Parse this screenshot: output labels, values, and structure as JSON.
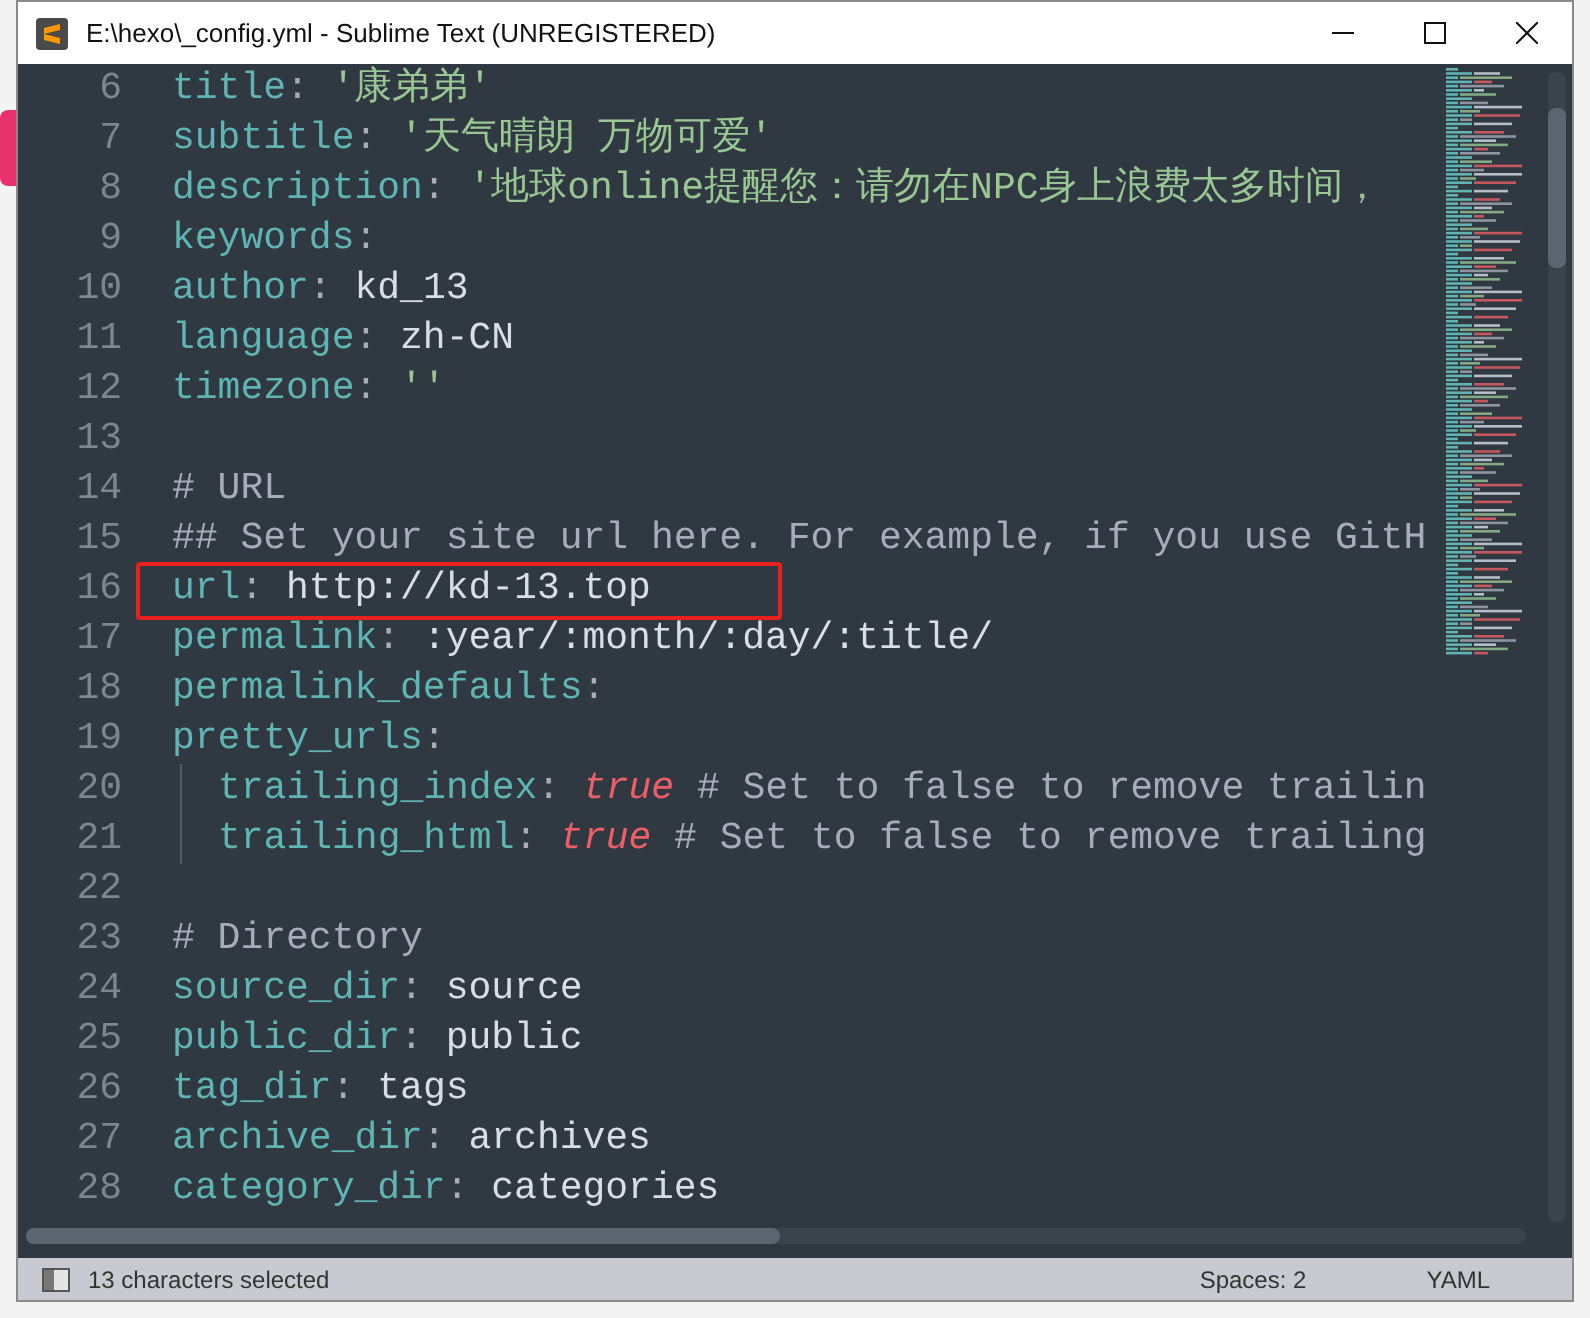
{
  "window": {
    "title": "E:\\hexo\\_config.yml - Sublime Text (UNREGISTERED)"
  },
  "lines": [
    {
      "number": "6",
      "indented": false,
      "boxed": false,
      "tokens": [
        {
          "kind": "key",
          "text": "title"
        },
        {
          "kind": "punct",
          "text": ": "
        },
        {
          "kind": "string",
          "text": "'康弟弟'"
        }
      ]
    },
    {
      "number": "7",
      "indented": false,
      "boxed": false,
      "tokens": [
        {
          "kind": "key",
          "text": "subtitle"
        },
        {
          "kind": "punct",
          "text": ": "
        },
        {
          "kind": "string",
          "text": "'天气晴朗 万物可爱'"
        }
      ]
    },
    {
      "number": "8",
      "indented": false,
      "boxed": false,
      "tokens": [
        {
          "kind": "key",
          "text": "description"
        },
        {
          "kind": "punct",
          "text": ": "
        },
        {
          "kind": "string",
          "text": "'地球online提醒您：请勿在NPC身上浪费太多时间，"
        }
      ]
    },
    {
      "number": "9",
      "indented": false,
      "boxed": false,
      "tokens": [
        {
          "kind": "key",
          "text": "keywords"
        },
        {
          "kind": "punct",
          "text": ":"
        }
      ]
    },
    {
      "number": "10",
      "indented": false,
      "boxed": false,
      "tokens": [
        {
          "kind": "key",
          "text": "author"
        },
        {
          "kind": "punct",
          "text": ": "
        },
        {
          "kind": "value",
          "text": "kd_13"
        }
      ]
    },
    {
      "number": "11",
      "indented": false,
      "boxed": false,
      "tokens": [
        {
          "kind": "key",
          "text": "language"
        },
        {
          "kind": "punct",
          "text": ": "
        },
        {
          "kind": "value",
          "text": "zh-CN"
        }
      ]
    },
    {
      "number": "12",
      "indented": false,
      "boxed": false,
      "tokens": [
        {
          "kind": "key",
          "text": "timezone"
        },
        {
          "kind": "punct",
          "text": ": "
        },
        {
          "kind": "string",
          "text": "''"
        }
      ]
    },
    {
      "number": "13",
      "boxed": false
    },
    {
      "number": "14",
      "indented": false,
      "boxed": false,
      "tokens": [
        {
          "kind": "comment",
          "text": "# URL"
        }
      ]
    },
    {
      "number": "15",
      "indented": false,
      "boxed": false,
      "tokens": [
        {
          "kind": "comment",
          "text": "## Set your site url here. For example, if you use GitH"
        }
      ]
    },
    {
      "number": "16",
      "indented": false,
      "boxed": true,
      "tokens": [
        {
          "kind": "key",
          "text": "url"
        },
        {
          "kind": "punct",
          "text": ": "
        },
        {
          "kind": "value",
          "text": "http://kd-13.top"
        }
      ]
    },
    {
      "number": "17",
      "indented": false,
      "boxed": false,
      "tokens": [
        {
          "kind": "key",
          "text": "permalink"
        },
        {
          "kind": "punct",
          "text": ": "
        },
        {
          "kind": "value",
          "text": ":year/:month/:day/:title/"
        }
      ]
    },
    {
      "number": "18",
      "indented": false,
      "boxed": false,
      "tokens": [
        {
          "kind": "key",
          "text": "permalink_defaults"
        },
        {
          "kind": "punct",
          "text": ":"
        }
      ]
    },
    {
      "number": "19",
      "indented": false,
      "boxed": false,
      "tokens": [
        {
          "kind": "key",
          "text": "pretty_urls"
        },
        {
          "kind": "punct",
          "text": ":"
        }
      ]
    },
    {
      "number": "20",
      "indented": true,
      "boxed": false,
      "tokens": [
        {
          "kind": "key",
          "text": "trailing_index"
        },
        {
          "kind": "punct",
          "text": ": "
        },
        {
          "kind": "bool",
          "text": "true"
        },
        {
          "kind": "comment",
          "text": " # Set to false to remove trailin"
        }
      ]
    },
    {
      "number": "21",
      "indented": true,
      "boxed": false,
      "tokens": [
        {
          "kind": "key",
          "text": "trailing_html"
        },
        {
          "kind": "punct",
          "text": ": "
        },
        {
          "kind": "bool",
          "text": "true"
        },
        {
          "kind": "comment",
          "text": " # Set to false to remove trailing"
        }
      ]
    },
    {
      "number": "22",
      "boxed": false
    },
    {
      "number": "23",
      "indented": false,
      "boxed": false,
      "tokens": [
        {
          "kind": "comment",
          "text": "# Directory"
        }
      ]
    },
    {
      "number": "24",
      "indented": false,
      "boxed": false,
      "tokens": [
        {
          "kind": "key",
          "text": "source_dir"
        },
        {
          "kind": "punct",
          "text": ": "
        },
        {
          "kind": "value",
          "text": "source"
        }
      ]
    },
    {
      "number": "25",
      "indented": false,
      "boxed": false,
      "tokens": [
        {
          "kind": "key",
          "text": "public_dir"
        },
        {
          "kind": "punct",
          "text": ": "
        },
        {
          "kind": "value",
          "text": "public"
        }
      ]
    },
    {
      "number": "26",
      "indented": false,
      "boxed": false,
      "tokens": [
        {
          "kind": "key",
          "text": "tag_dir"
        },
        {
          "kind": "punct",
          "text": ": "
        },
        {
          "kind": "value",
          "text": "tags"
        }
      ]
    },
    {
      "number": "27",
      "indented": false,
      "boxed": false,
      "tokens": [
        {
          "kind": "key",
          "text": "archive_dir"
        },
        {
          "kind": "punct",
          "text": ": "
        },
        {
          "kind": "value",
          "text": "archives"
        }
      ]
    },
    {
      "number": "28",
      "indented": false,
      "boxed": false,
      "tokens": [
        {
          "kind": "key",
          "text": "category_dir"
        },
        {
          "kind": "punct",
          "text": ": "
        },
        {
          "kind": "value",
          "text": "categories"
        }
      ]
    }
  ],
  "status_bar": {
    "selection": "13 characters selected",
    "indentation": "Spaces: 2",
    "syntax": "YAML"
  }
}
